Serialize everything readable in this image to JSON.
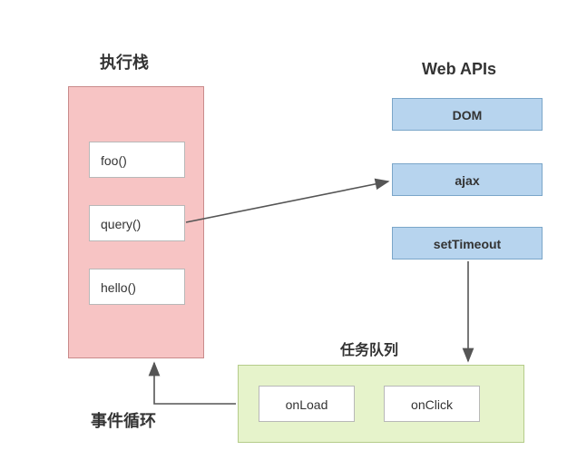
{
  "titles": {
    "call_stack": "执行栈",
    "web_apis": "Web APIs",
    "task_queue": "任务队列",
    "event_loop": "事件循环"
  },
  "call_stack": {
    "frames": [
      {
        "label": "foo()"
      },
      {
        "label": "query()"
      },
      {
        "label": "hello()"
      }
    ]
  },
  "web_apis": {
    "items": [
      {
        "label": "DOM"
      },
      {
        "label": "ajax"
      },
      {
        "label": "setTimeout"
      }
    ]
  },
  "task_queue": {
    "tasks": [
      {
        "label": "onLoad"
      },
      {
        "label": "onClick"
      }
    ]
  },
  "arrows": [
    {
      "from": "call_stack.query",
      "to": "web_apis.ajax"
    },
    {
      "from": "web_apis.setTimeout",
      "to": "task_queue"
    },
    {
      "from": "task_queue",
      "to": "call_stack"
    }
  ],
  "colors": {
    "stack_bg": "#f7c4c4",
    "stack_border": "#c98b8b",
    "api_bg": "#b7d4ee",
    "api_border": "#7ba6c9",
    "queue_bg": "#e6f3cb",
    "queue_border": "#b5cc8a",
    "frame_bg": "#ffffff",
    "frame_border": "#b8b8b8",
    "arrow": "#555555"
  }
}
